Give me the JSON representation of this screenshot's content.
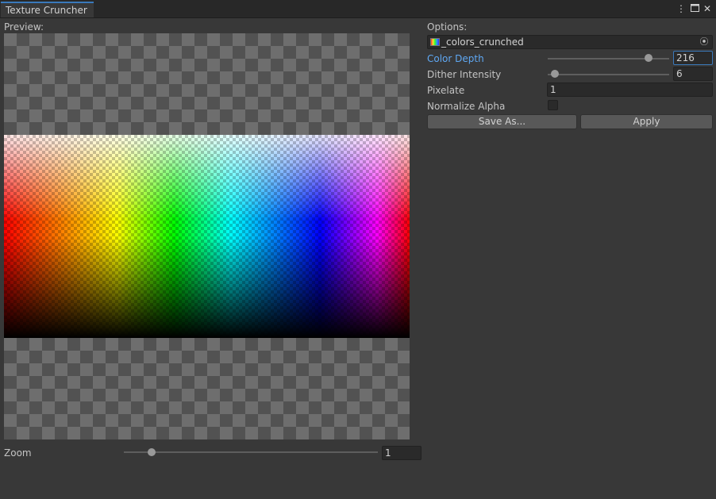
{
  "window": {
    "tab_title": "Texture Cruncher",
    "menu_icon": "kebab-menu-icon",
    "maximize_icon": "maximize-icon",
    "close_icon": "close-icon"
  },
  "preview": {
    "label": "Preview:",
    "zoom_label": "Zoom",
    "zoom_value": "1",
    "zoom_slider_level": 0.11
  },
  "options": {
    "label": "Options:",
    "texture_field": {
      "value": "_colors_crunched",
      "icon": "texture-icon",
      "picker_icon": "object-picker-icon"
    },
    "color_depth": {
      "label": "Color Depth",
      "value": "216",
      "slider_level": 0.83
    },
    "dither_intensity": {
      "label": "Dither Intensity",
      "value": "6",
      "slider_level": 0.06
    },
    "pixelate": {
      "label": "Pixelate",
      "value": "1"
    },
    "normalize_alpha": {
      "label": "Normalize Alpha",
      "checked": false
    },
    "save_button": "Save As...",
    "apply_button": "Apply"
  },
  "colors": {
    "background": "#383838",
    "accent": "#3a79bb",
    "highlight_label": "#5fa8f3"
  }
}
